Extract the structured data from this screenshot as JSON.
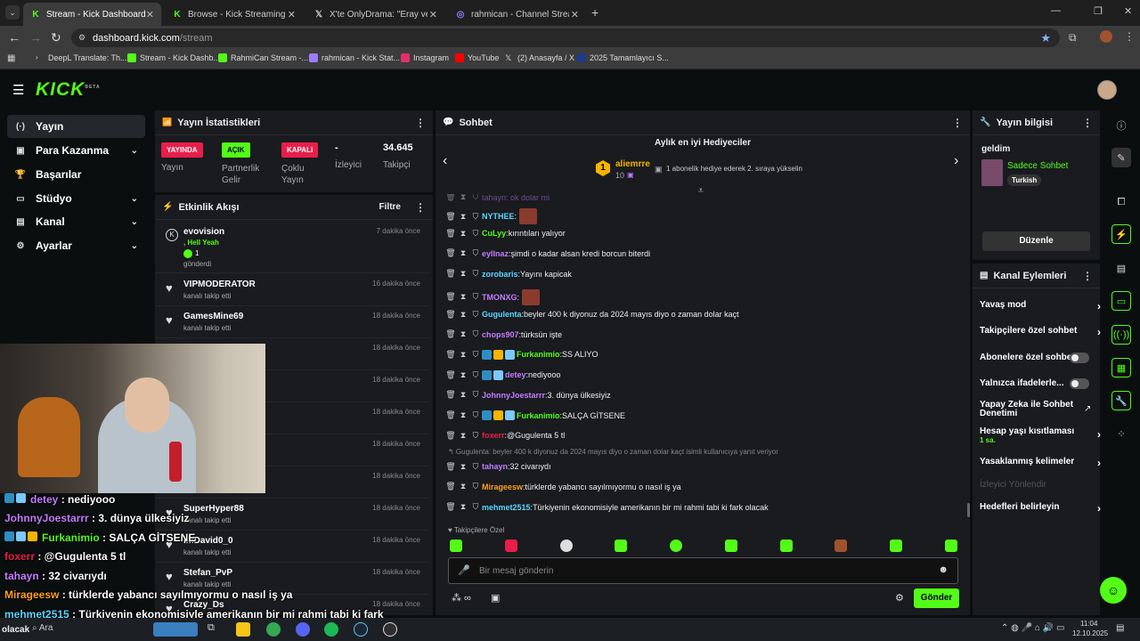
{
  "browser": {
    "tabs": [
      {
        "label": "Stream - Kick Dashboard",
        "active": true,
        "icon": "kick-icon"
      },
      {
        "label": "Browse - Kick Streaming",
        "icon": "kick-icon"
      },
      {
        "label": "X'te OnlyDrama: \"Eray ve Dizci",
        "icon": "x-icon"
      },
      {
        "label": "rahmican - Channel Streams on",
        "icon": "twitch-icon"
      }
    ],
    "new_tab": "+",
    "url_host": "dashboard.kick.com",
    "url_path": "/stream",
    "bookmarks": [
      "DeepL Translate: Th...",
      "Stream - Kick Dashb...",
      "RahmiCan Stream -...",
      "rahmican - Kick Stat...",
      "Instagram",
      "YouTube",
      "(2) Anasayfa / X",
      "2025 Tamamlayıcı S..."
    ]
  },
  "kick": {
    "logo": "KICK",
    "logo_sup": "BETA",
    "nav": [
      {
        "label": "Yayın",
        "icon": "broadcast-icon",
        "active": true
      },
      {
        "label": "Para Kazanma",
        "icon": "money-icon",
        "chev": true
      },
      {
        "label": "Başarılar",
        "icon": "trophy-icon"
      },
      {
        "label": "Stüdyo",
        "icon": "studio-icon",
        "chev": true
      },
      {
        "label": "Kanal",
        "icon": "channel-icon",
        "chev": true
      },
      {
        "label": "Ayarlar",
        "icon": "gear-icon",
        "chev": true
      }
    ]
  },
  "stats": {
    "title": "Yayın İstatistikleri",
    "items": [
      {
        "badge": "YAYINDA",
        "label": "Yayın",
        "color": "#e91e4a",
        "text": "#fff"
      },
      {
        "badge": "AÇIK",
        "label": "Partnerlik Gelir",
        "color": "#53fc18",
        "text": "#000"
      },
      {
        "badge": "KAPALI",
        "label": "Çoklu Yayın",
        "color": "#e91e4a",
        "text": "#fff"
      },
      {
        "value": "-",
        "label": "İzleyici"
      },
      {
        "value": "34.645",
        "label": "Takipçi"
      }
    ]
  },
  "activity": {
    "title": "Etkinlik Akışı",
    "filter": "Filtre",
    "events": [
      {
        "name": "evovision",
        "line2": ", Hell Yeah",
        "line3": "1",
        "line4": "gönderdi",
        "time": "7 dakika önce",
        "icon": "kick-k-icon"
      },
      {
        "name": "VIPMODERATOR",
        "sub": "kanalı takip etti",
        "time": "16 dakika önce"
      },
      {
        "name": "GamesMine69",
        "sub": "kanalı takip etti",
        "time": "18 dakika önce"
      },
      {
        "name": "",
        "sub": "",
        "time": "18 dakika önce"
      },
      {
        "name": "",
        "sub": "",
        "time": "18 dakika önce"
      },
      {
        "name": "",
        "sub": "",
        "time": "18 dakika önce"
      },
      {
        "name": "",
        "sub": "",
        "time": "18 dakika önce"
      },
      {
        "name": "",
        "sub": "",
        "time": "18 dakika önce"
      },
      {
        "name": "SuperHyper88",
        "sub": "kanalı takip etti",
        "time": "18 dakika önce"
      },
      {
        "name": "imDavid0_0",
        "sub": "kanalı takip etti",
        "time": "18 dakika önce"
      },
      {
        "name": "Stefan_PvP",
        "sub": "kanalı takip etti",
        "time": "18 dakika önce"
      },
      {
        "name": "Crazy_Ds",
        "sub": "",
        "time": "18 dakika önce"
      }
    ]
  },
  "chat": {
    "title": "Sohbet",
    "top_gifters_title": "Aylık en iyi Hediyeciler",
    "top_gifter": {
      "rank": "1",
      "name": "aliemrre",
      "count": "10",
      "note": "1 abonelik hediye ederek 2. sıraya yükselin"
    },
    "cut_line": "tahayn: ok dolar mi",
    "messages": [
      {
        "user": "NYTHEE",
        "color": "#5bd6ff",
        "text": "",
        "emote": true
      },
      {
        "user": "CuLyy",
        "color": "#53fc18",
        "text": " kırıntıları yalıyor"
      },
      {
        "user": "eyllnaz",
        "color": "#c47cff",
        "text": " şimdi o kadar alsan kredi borcun biterdi"
      },
      {
        "user": "zorobaris",
        "color": "#5bd6ff",
        "text": " Yayını kapicak"
      },
      {
        "user": "TMONXG",
        "color": "#c47cff",
        "text": "",
        "emote": true
      },
      {
        "user": "Gugulenta",
        "color": "#5bd6ff",
        "text": " beyler 400 k diyonuz da 2024 mayıs diyo o zaman dolar kaçt"
      },
      {
        "user": "chops907",
        "color": "#c47cff",
        "text": " türksün işte"
      },
      {
        "user": "Furkanimio",
        "color": "#53fc18",
        "text": " SS ALIYO",
        "badges": true
      },
      {
        "user": "detey",
        "color": "#c47cff",
        "text": " nediyooo",
        "badges2": true
      },
      {
        "user": "JohnnyJoestarrr",
        "color": "#c47cff",
        "text": " 3. dünya ülkesiyiz"
      },
      {
        "user": "Furkanimio",
        "color": "#53fc18",
        "text": " SALÇA GİTSENE",
        "badges": true
      },
      {
        "user": "foxerr",
        "color": "#e91e4a",
        "text": " @Gugulenta 5 tl"
      },
      {
        "user": "tahayn",
        "color": "#c47cff",
        "text": " 32 civarıydı",
        "reply": "Gugulenta: beyler 400 k diyonuz da 2024 mayıs diyo o zaman dolar kaçt isimli kullanıcıya yanıt veriyor"
      },
      {
        "user": "Mirageesw",
        "color": "#ff9f1c",
        "text": " türklerde yabancı sayılmıyormu o nasıl iş ya"
      },
      {
        "user": "mehmet2515",
        "color": "#5bd6ff",
        "text": " Türkiyenin ekonomisiyle amerikanın bir mi rahmi tabi ki fark olacak"
      }
    ],
    "followers_only": "Takipçilere Özel",
    "input_placeholder": "Bir mesaj gönderin",
    "send": "Gönder",
    "infinity": "∞"
  },
  "stream_info": {
    "title": "Yayın bilgisi",
    "stream_title": "geldim",
    "category": "Sadece Sohbet",
    "language": "Turkish",
    "edit": "Düzenle"
  },
  "channel_actions": {
    "title": "Kanal Eylemleri",
    "rows": [
      {
        "label": "Yavaş mod",
        "type": "chev"
      },
      {
        "label": "Takipçilere özel sohbet",
        "type": "chev"
      },
      {
        "label": "Abonelere özel sohbet",
        "type": "toggle"
      },
      {
        "label": "Yalnızca ifadelerle...",
        "type": "toggle"
      },
      {
        "label": "Yapay Zeka ile Sohbet Denetimi",
        "type": "ext"
      },
      {
        "label": "Hesap yaşı kısıtlaması",
        "sub": "1 sa.",
        "type": "chev"
      },
      {
        "label": "Yasaklanmış kelimeler",
        "type": "chev"
      },
      {
        "label": "İzleyici Yönlendir",
        "type": "disabled"
      },
      {
        "label": "Hedefleri belirleyin",
        "type": "chev"
      }
    ]
  },
  "overlay_chat": [
    {
      "user": "detey",
      "text": " : nediyooo",
      "color": "#c47cff"
    },
    {
      "user": "JohnnyJoestarrr",
      "text": " : 3. dünya ülkesiyiz",
      "color": "#c47cff"
    },
    {
      "user": "Furkanimio",
      "text": " : SALÇA GİTSENE",
      "color": "#53fc18"
    },
    {
      "user": "foxerr",
      "text": " : @Gugulenta 5 tl",
      "color": "#e91e4a"
    },
    {
      "user": "tahayn",
      "text": " : 32 civarıydı",
      "color": "#c47cff"
    },
    {
      "user": "Mirageesw",
      "text": " : türklerde yabancı sayılmıyormu o nasıl iş ya",
      "color": "#ff9f1c"
    },
    {
      "user": "mehmet2515",
      "text": " : Türkiyenin ekonomisiyle amerikanın bir mi rahmi tabi ki fark",
      "color": "#5bd6ff"
    },
    {
      "user": "olacak",
      "text": "",
      "color": "#fff"
    }
  ],
  "taskbar": {
    "search": "Ara",
    "time": "11:04",
    "date": "12.10.2025"
  },
  "colors": {
    "kick_green": "#53fc18",
    "panel": "#191b1f",
    "bg": "#0b0e0f"
  }
}
